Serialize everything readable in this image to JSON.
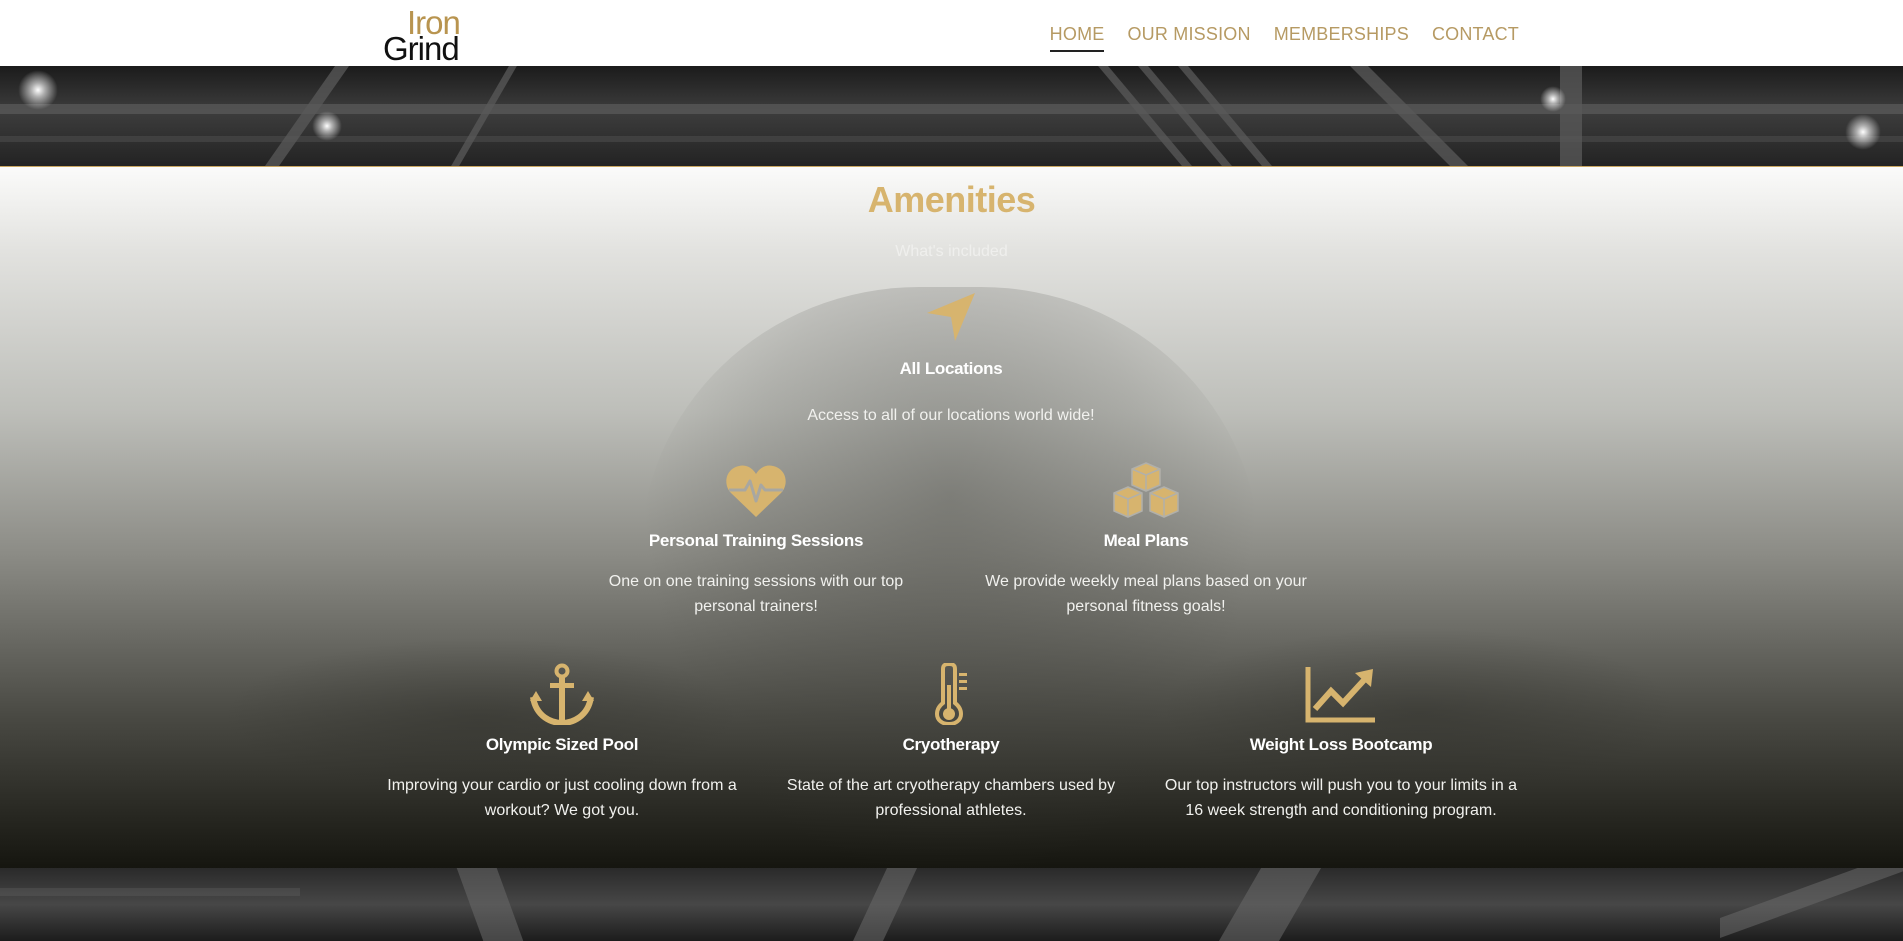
{
  "brand": {
    "line1": "Iron",
    "line2": "Grind"
  },
  "nav": [
    {
      "label": "HOME",
      "active": true
    },
    {
      "label": "OUR MISSION",
      "active": false
    },
    {
      "label": "MEMBERSHIPS",
      "active": false
    },
    {
      "label": "CONTACT",
      "active": false
    }
  ],
  "amenities": {
    "title": "Amenities",
    "subtitle": "What's included",
    "items": [
      {
        "icon": "location-arrow-icon",
        "name": "All Locations",
        "desc": "Access to all of our locations world wide!"
      },
      {
        "icon": "heartbeat-icon",
        "name": "Personal Training Sessions",
        "desc": "One on one training sessions with our top personal trainers!"
      },
      {
        "icon": "cubes-icon",
        "name": "Meal Plans",
        "desc": "We provide weekly meal plans based on your personal fitness goals!"
      },
      {
        "icon": "anchor-icon",
        "name": "Olympic Sized Pool",
        "desc": "Improving your cardio or just cooling down from a workout? We got you."
      },
      {
        "icon": "thermometer-icon",
        "name": "Cryotherapy",
        "desc": "State of the art cryotherapy chambers used by professional athletes."
      },
      {
        "icon": "line-chart-icon",
        "name": "Weight Loss Bootcamp",
        "desc": "Our top instructors will push you to your limits in a 16 week strength and conditioning program."
      }
    ]
  },
  "colors": {
    "accent": "#d7b46e",
    "brand_gold": "#b8944f",
    "nav_text": "#b69a63"
  }
}
